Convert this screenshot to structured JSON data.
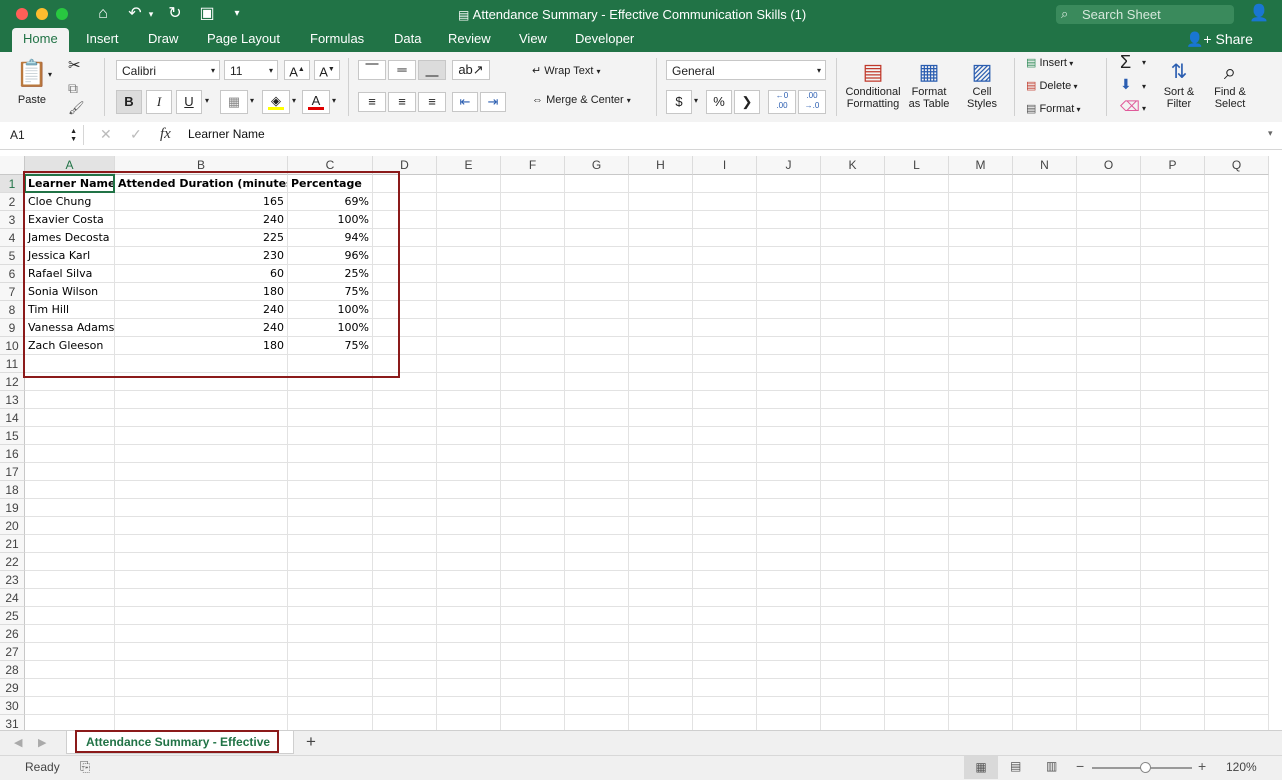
{
  "window": {
    "title": "Attendance Summary - Effective Communication Skills (1)",
    "search_placeholder": "Search Sheet"
  },
  "ribbon_tabs": [
    "Home",
    "Insert",
    "Draw",
    "Page Layout",
    "Formulas",
    "Data",
    "Review",
    "View",
    "Developer"
  ],
  "share_label": "Share",
  "ribbon": {
    "paste_label": "Paste",
    "font_name": "Calibri",
    "font_size": "11",
    "wrap_text": "Wrap Text",
    "merge_center": "Merge & Center",
    "number_format": "General",
    "conditional_formatting": [
      "Conditional",
      "Formatting"
    ],
    "format_as_table": [
      "Format",
      "as Table"
    ],
    "cell_styles": [
      "Cell",
      "Styles"
    ],
    "insert": "Insert",
    "delete": "Delete",
    "format": "Format",
    "sort_filter": [
      "Sort &",
      "Filter"
    ],
    "find_select": [
      "Find &",
      "Select"
    ]
  },
  "formula_bar": {
    "name_box": "A1",
    "formula": "Learner Name"
  },
  "columns": [
    "A",
    "B",
    "C",
    "D",
    "E",
    "F",
    "G",
    "H",
    "I",
    "J",
    "K",
    "L",
    "M",
    "N",
    "O",
    "P",
    "Q"
  ],
  "rows": [
    "1",
    "2",
    "3",
    "4",
    "5",
    "6",
    "7",
    "8",
    "9",
    "10",
    "11",
    "12",
    "13",
    "14",
    "15",
    "16",
    "17",
    "18",
    "19",
    "20",
    "21",
    "22",
    "23",
    "24",
    "25",
    "26",
    "27",
    "28",
    "29",
    "30",
    "31"
  ],
  "table": {
    "headers": [
      "Learner Name",
      "Attended Duration (minutes)",
      "Percentage"
    ],
    "rows": [
      [
        "Cloe Chung",
        "165",
        "69%"
      ],
      [
        "Exavier Costa",
        "240",
        "100%"
      ],
      [
        "James Decosta",
        "225",
        "94%"
      ],
      [
        "Jessica Karl",
        "230",
        "96%"
      ],
      [
        "Rafael Silva",
        "60",
        "25%"
      ],
      [
        "Sonia Wilson",
        "180",
        "75%"
      ],
      [
        "Tim Hill",
        "240",
        "100%"
      ],
      [
        "Vanessa Adams",
        "240",
        "100%"
      ],
      [
        "Zach Gleeson",
        "180",
        "75%"
      ]
    ]
  },
  "sheet_tab": "Attendance Summary - Effective",
  "status": {
    "ready": "Ready",
    "zoom": "120%"
  },
  "colors": {
    "excel_green": "#217346",
    "highlight_border": "#8b1a1a"
  }
}
